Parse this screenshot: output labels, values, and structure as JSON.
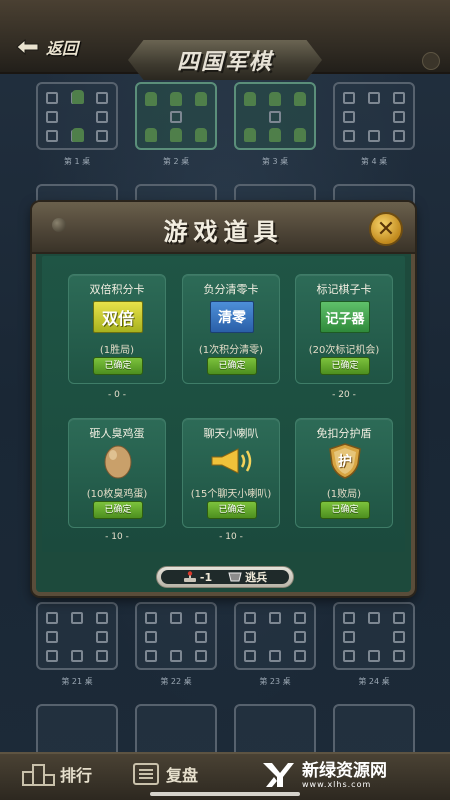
{
  "topbar": {
    "back_label": "返回",
    "title": "四国军棋"
  },
  "tables": {
    "top_labels": [
      "第 1 桌",
      "第 2 桌",
      "第 3 桌",
      "第 4 桌"
    ],
    "bottom_labels": [
      "第 21 桌",
      "第 22 桌",
      "第 23 桌",
      "第 24 桌"
    ]
  },
  "dialog": {
    "title": "游戏道具",
    "close_label": "✕",
    "items": [
      {
        "name": "双倍积分卡",
        "icon_text": "双倍",
        "desc": "(1胜局)",
        "button": "已确定",
        "count": "- 0 -"
      },
      {
        "name": "负分清零卡",
        "icon_text": "清零",
        "desc": "(1次积分清零)",
        "button": "已确定",
        "count": ""
      },
      {
        "name": "标记棋子卡",
        "icon_text": "记子器",
        "desc": "(20次标记机会)",
        "button": "已确定",
        "count": "- 20 -"
      },
      {
        "name": "砸人臭鸡蛋",
        "icon_text": "",
        "desc": "(10枚臭鸡蛋)",
        "button": "已确定",
        "count": "- 10 -"
      },
      {
        "name": "聊天小喇叭",
        "icon_text": "",
        "desc": "(15个聊天小喇叭)",
        "button": "已确定",
        "count": "- 10 -"
      },
      {
        "name": "免扣分护盾",
        "icon_text": "护",
        "desc": "(1败局)",
        "button": "已确定",
        "count": ""
      }
    ],
    "footer": {
      "score": "-1",
      "status": "逃兵"
    }
  },
  "bottom_nav": {
    "rank": "排行",
    "replay": "复盘"
  },
  "watermark": {
    "name": "新绿资源网",
    "url": "www.xlhs.com"
  },
  "colors": {
    "dialog_bg": "#1d4a3c",
    "button_green": "#6ab32f",
    "accent_gold": "#e0a93a"
  }
}
